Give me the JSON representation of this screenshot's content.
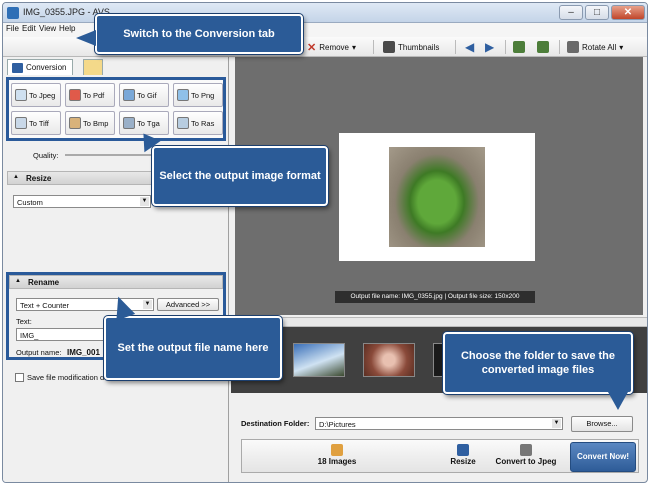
{
  "window": {
    "title": "IMG_0355.JPG - AVS"
  },
  "menu": [
    "File",
    "Edit",
    "View",
    "Help"
  ],
  "toolbar": {
    "remove": "Remove",
    "thumbnails": "Thumbnails",
    "rotate_all": "Rotate All"
  },
  "left_panel": {
    "tab_conversion": "Conversion",
    "formats": [
      "To Jpeg",
      "To Pdf",
      "To Gif",
      "To Png",
      "To Tiff",
      "To Bmp",
      "To Tga",
      "To Ras"
    ],
    "quality_label": "Quality:",
    "resize_header": "Resize",
    "resize_value": "Custom",
    "rename_header": "Rename",
    "rename_mode": "Text + Counter",
    "advanced_button": "Advanced >>",
    "text_label": "Text:",
    "text_value": "IMG_",
    "output_name_label": "Output name:",
    "output_name_value": "IMG_001",
    "save_modification_label": "Save file modification dat"
  },
  "preview": {
    "caption": "Output file name: IMG_0355.jpg | Output file size: 150x200"
  },
  "destination": {
    "label": "Destination Folder:",
    "value": "D:\\Pictures",
    "browse": "Browse..."
  },
  "steps": {
    "images": "18 Images",
    "resize": "Resize",
    "convert_to": "Convert to Jpeg",
    "convert_now": "Convert Now!"
  },
  "callouts": {
    "conversion_tab": "Switch to the Conversion tab",
    "output_format": "Select the output image format",
    "file_name": "Set the output file name here",
    "folder": "Choose the folder to save the converted image files"
  },
  "colors": {
    "callout_bg": "#2b5b97",
    "highlight_border": "#2a5a9a"
  }
}
